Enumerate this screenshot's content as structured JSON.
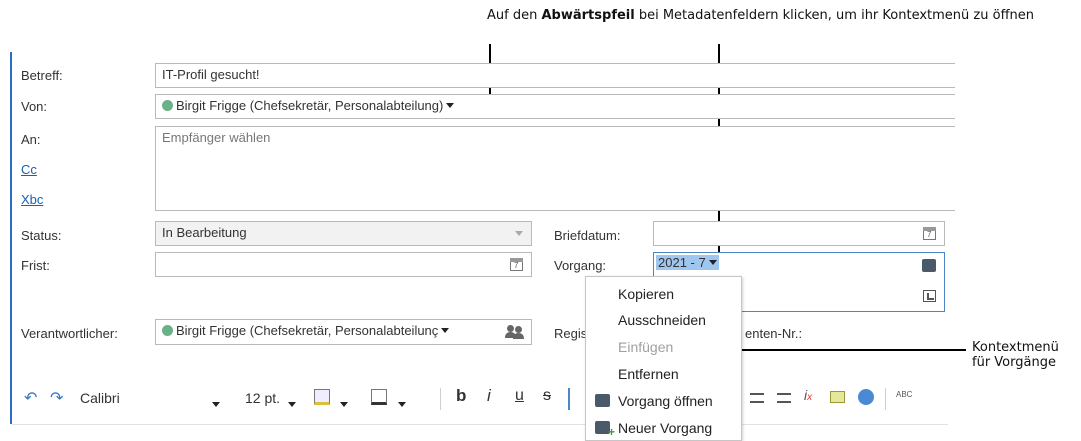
{
  "callouts": {
    "top_prefix": "Auf den ",
    "top_bold": "Abwärtspfeil",
    "top_suffix": " bei Metadatenfeldern klicken, um ihr Kontextmenü zu öffnen",
    "right_line1": "Kontextmenü",
    "right_line2": "für Vorgänge"
  },
  "form": {
    "betreff_label": "Betreff:",
    "betreff_value": "IT-Profil gesucht!",
    "von_label": "Von:",
    "von_value": "Birgit Frigge (Chefsekretär, Personalabteilung)",
    "an_label": "An:",
    "an_placeholder": "Empfänger wählen",
    "cc_label": "Cc",
    "xbc_label": "Xbc",
    "status_label": "Status:",
    "status_value": "In Bearbeitung",
    "frist_label": "Frist:",
    "frist_value": "",
    "briefdatum_label": "Briefdatum:",
    "briefdatum_value": "",
    "vorgang_label": "Vorgang:",
    "vorgang_value": "2021 - 7",
    "verantwortlicher_label": "Verantwortlicher:",
    "verantwortlicher_value": "Birgit Frigge (Chefsekretär, Personalabteilunç",
    "regis_label": "Regis",
    "dokumente_label": "enten-Nr.:"
  },
  "context_menu": {
    "items": [
      {
        "label": "Kopieren",
        "enabled": true
      },
      {
        "label": "Ausschneiden",
        "enabled": true
      },
      {
        "label": "Einfügen",
        "enabled": false
      },
      {
        "label": "Entfernen",
        "enabled": true
      },
      {
        "label": "Vorgang öffnen",
        "enabled": true,
        "icon": "case-icon"
      },
      {
        "label": "Neuer Vorgang",
        "enabled": true,
        "icon": "new-case-icon"
      }
    ]
  },
  "toolbar": {
    "undo_icon": "↶",
    "redo_icon": "↷",
    "font": "Calibri",
    "size": "12 pt.",
    "bold": "b",
    "italic": "i",
    "underline": "u",
    "strike": "s",
    "spell": "ABC"
  },
  "colors": {
    "accent": "#2b6cc4",
    "status_dot": "#6ab187",
    "selection": "#9fc6ee"
  }
}
